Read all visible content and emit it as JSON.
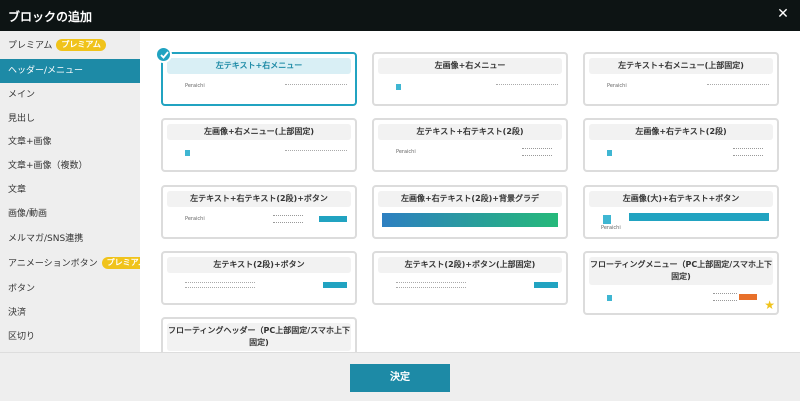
{
  "dialog": {
    "title": "ブロックの追加",
    "close_label": "✕"
  },
  "sidebar": {
    "items": [
      {
        "label": "プレミアム",
        "badge": "プレミアム"
      },
      {
        "label": "ヘッダー/メニュー"
      },
      {
        "label": "メイン"
      },
      {
        "label": "見出し"
      },
      {
        "label": "文章+画像"
      },
      {
        "label": "文章+画像（複数）"
      },
      {
        "label": "文章"
      },
      {
        "label": "画像/動画"
      },
      {
        "label": "メルマガ/SNS連携"
      },
      {
        "label": "アニメーションボタン",
        "badge": "プレミアム"
      },
      {
        "label": "ボタン"
      },
      {
        "label": "決済"
      },
      {
        "label": "区切り"
      }
    ],
    "active_index": 1
  },
  "blocks": [
    {
      "title": "左テキスト+右メニュー",
      "preview_logo": "Peraichi"
    },
    {
      "title": "左画像+右メニュー"
    },
    {
      "title": "左テキスト+右メニュー(上部固定)",
      "preview_logo": "Peraichi"
    },
    {
      "title": "左画像+右メニュー(上部固定)"
    },
    {
      "title": "左テキスト+右テキスト(2段)",
      "preview_logo": "Peraichi"
    },
    {
      "title": "左画像+右テキスト(2段)"
    },
    {
      "title": "左テキスト+右テキスト(2段)+ボタン",
      "preview_logo": "Peraichi"
    },
    {
      "title": "左画像+右テキスト(2段)+背景グラデ"
    },
    {
      "title": "左画像(大)+右テキスト+ボタン",
      "preview_logo": "Peraichi"
    },
    {
      "title": "左テキスト(2段)+ボタン"
    },
    {
      "title": "左テキスト(2段)+ボタン(上部固定)"
    },
    {
      "title": "フローティングメニュー（PC上部固定/スマホ上下固定)"
    },
    {
      "title": "フローティングヘッダー（PC上部固定/スマホ上下固定)"
    }
  ],
  "selected_block_index": 0,
  "footer": {
    "confirm_label": "決定"
  },
  "colors": {
    "accent": "#1d8aa6",
    "premium": "#f0c31b",
    "titlebar": "#0d1414"
  }
}
